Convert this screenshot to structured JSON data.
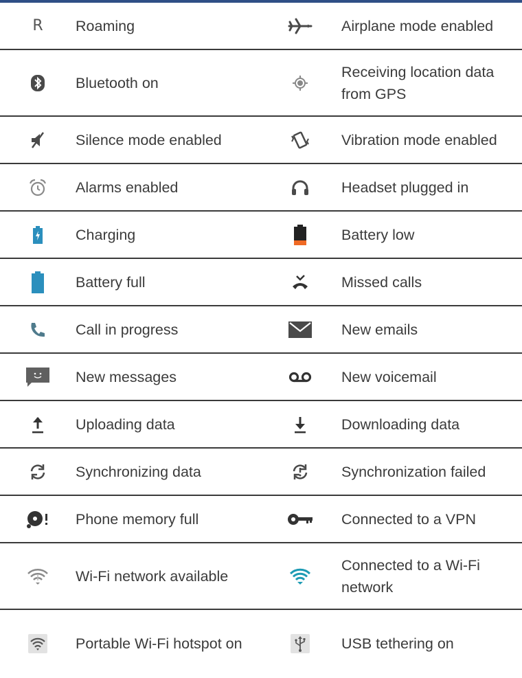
{
  "rows": [
    {
      "left": {
        "icon": "roaming-icon",
        "glyph": "R",
        "label": "Roaming"
      },
      "right": {
        "icon": "airplane-mode-icon",
        "label": "Airplane mode enabled"
      }
    },
    {
      "left": {
        "icon": "bluetooth-icon",
        "label": "Bluetooth on"
      },
      "right": {
        "icon": "gps-icon",
        "label": "Receiving location data from GPS"
      }
    },
    {
      "left": {
        "icon": "silence-mode-icon",
        "label": "Silence mode enabled"
      },
      "right": {
        "icon": "vibration-mode-icon",
        "label": "Vibration mode enabled"
      }
    },
    {
      "left": {
        "icon": "alarm-icon",
        "label": "Alarms enabled"
      },
      "right": {
        "icon": "headset-icon",
        "label": "Headset plugged in"
      }
    },
    {
      "left": {
        "icon": "battery-charging-icon",
        "label": "Charging"
      },
      "right": {
        "icon": "battery-low-icon",
        "label": "Battery low"
      }
    },
    {
      "left": {
        "icon": "battery-full-icon",
        "label": "Battery full"
      },
      "right": {
        "icon": "missed-call-icon",
        "label": "Missed calls"
      }
    },
    {
      "left": {
        "icon": "call-in-progress-icon",
        "label": "Call in progress"
      },
      "right": {
        "icon": "email-icon",
        "label": "New emails"
      }
    },
    {
      "left": {
        "icon": "message-icon",
        "label": "New messages"
      },
      "right": {
        "icon": "voicemail-icon",
        "label": "New voicemail"
      }
    },
    {
      "left": {
        "icon": "upload-icon",
        "label": "Uploading data"
      },
      "right": {
        "icon": "download-icon",
        "label": "Downloading data"
      }
    },
    {
      "left": {
        "icon": "sync-icon",
        "label": "Synchronizing data"
      },
      "right": {
        "icon": "sync-failed-icon",
        "label": "Synchronization failed"
      }
    },
    {
      "left": {
        "icon": "memory-full-icon",
        "label": "Phone memory full"
      },
      "right": {
        "icon": "vpn-key-icon",
        "label": "Connected to a VPN"
      }
    },
    {
      "left": {
        "icon": "wifi-available-icon",
        "label": "Wi-Fi network available"
      },
      "right": {
        "icon": "wifi-connected-icon",
        "label": "Connected to a Wi-Fi network"
      }
    },
    {
      "left": {
        "icon": "wifi-hotspot-icon",
        "label": "Portable Wi-Fi hotspot on"
      },
      "right": {
        "icon": "usb-tethering-icon",
        "label": "USB tethering on"
      }
    }
  ],
  "colors": {
    "rule": "#2f4f86",
    "text": "#3b3b3b",
    "icon_gray": "#5f5f5f",
    "accent_blue": "#2b8fbd",
    "battery_orange": "#f06a24"
  }
}
